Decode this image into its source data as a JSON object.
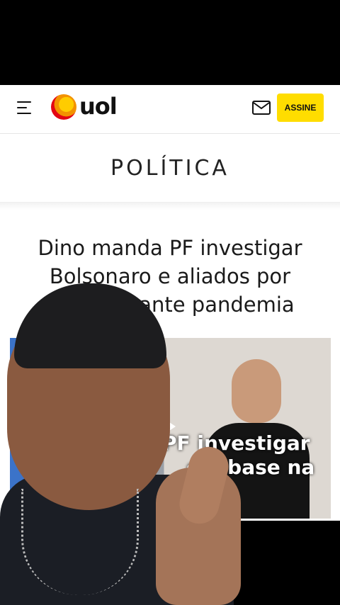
{
  "header": {
    "logo_text": "uol",
    "subscribe_label": "ASSINE"
  },
  "section": {
    "title": "POLÍTICA"
  },
  "article": {
    "headline_line1": "Dino manda PF investigar",
    "headline_line2": "Bolsonaro e aliados por",
    "headline_line3": "rante pandemia",
    "image_overlay_line1": "PF investigar",
    "image_overlay_line2": "om base na"
  },
  "colors": {
    "accent_yellow": "#ffdd00",
    "logo_red": "#e30613",
    "logo_orange": "#f39200"
  }
}
